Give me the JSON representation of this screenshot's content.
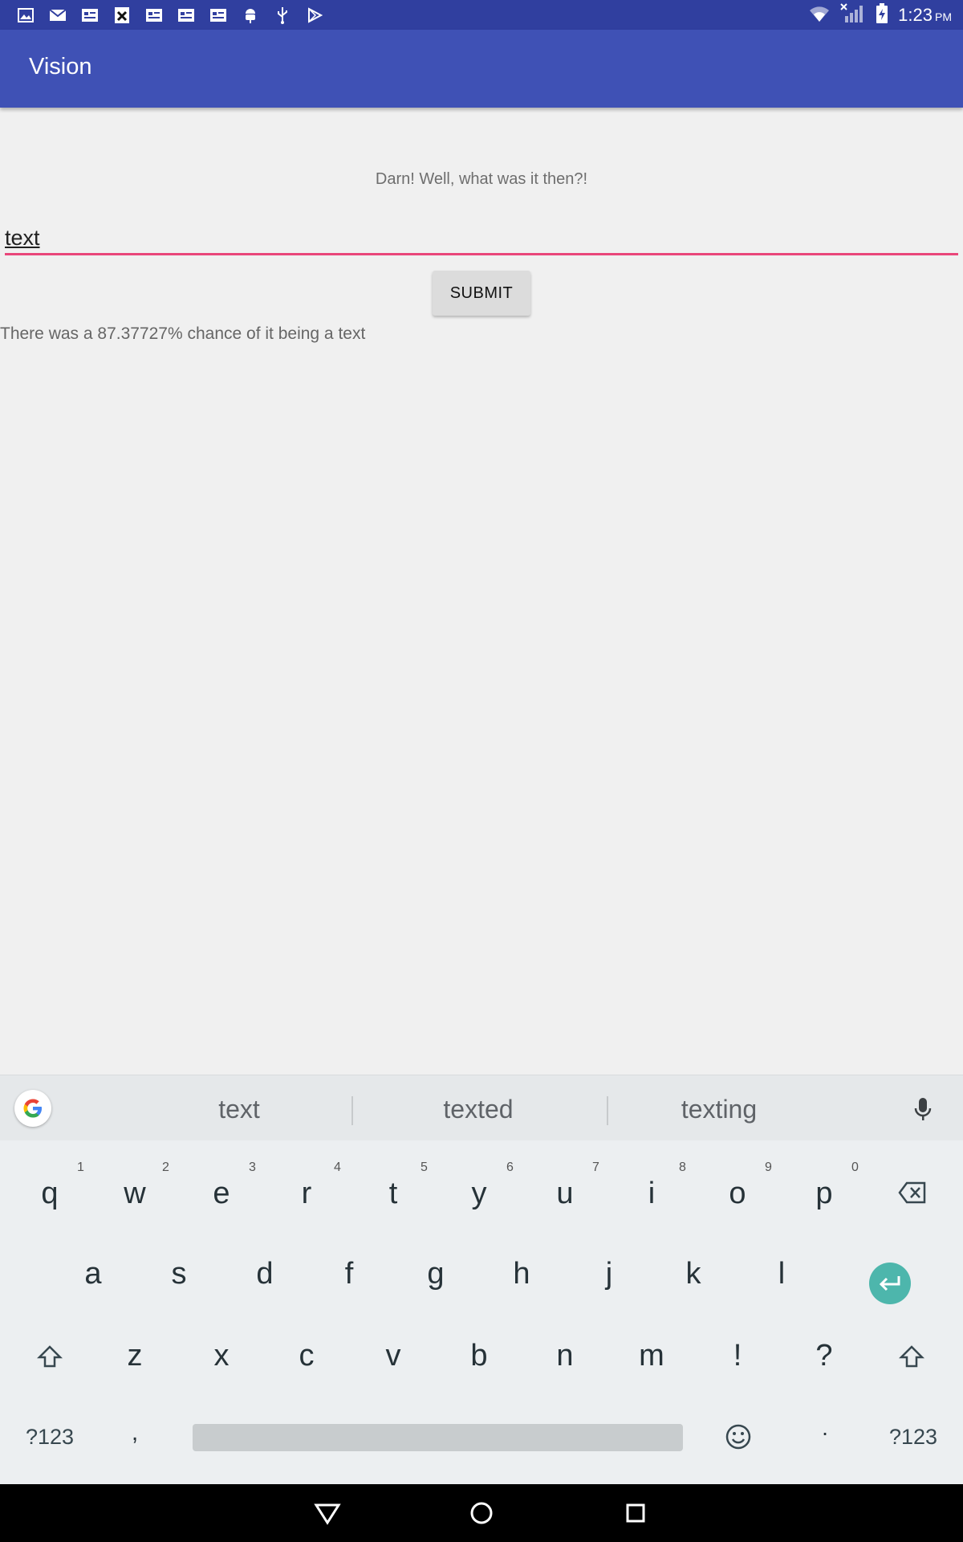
{
  "status_bar": {
    "time": "1:23",
    "ampm": "PM",
    "left_icons": [
      "image-icon",
      "mail-icon",
      "card-icon",
      "close-doc-icon",
      "card-icon",
      "card-icon",
      "card-icon",
      "android-icon",
      "usb-icon",
      "play-store-icon"
    ],
    "right_icons": [
      "wifi-icon",
      "signal-icon",
      "battery-charging-icon"
    ]
  },
  "app_bar": {
    "title": "Vision"
  },
  "main": {
    "prompt": "Darn! Well, what was it then?!",
    "answer_value": "text",
    "submit_label": "SUBMIT",
    "result_text": "There was a 87.37727% chance of it being a text"
  },
  "keyboard": {
    "suggestions": [
      "text",
      "texted",
      "texting"
    ],
    "row1": [
      {
        "key": "q",
        "hint": "1"
      },
      {
        "key": "w",
        "hint": "2"
      },
      {
        "key": "e",
        "hint": "3"
      },
      {
        "key": "r",
        "hint": "4"
      },
      {
        "key": "t",
        "hint": "5"
      },
      {
        "key": "y",
        "hint": "6"
      },
      {
        "key": "u",
        "hint": "7"
      },
      {
        "key": "i",
        "hint": "8"
      },
      {
        "key": "o",
        "hint": "9"
      },
      {
        "key": "p",
        "hint": "0"
      }
    ],
    "row2": [
      "a",
      "s",
      "d",
      "f",
      "g",
      "h",
      "j",
      "k",
      "l"
    ],
    "row3": [
      "z",
      "x",
      "c",
      "v",
      "b",
      "n",
      "m",
      "!",
      "?"
    ],
    "symbols_label": "?123",
    "comma_label": ",",
    "period_label": "·"
  },
  "colors": {
    "status_bar": "#303f9f",
    "app_bar": "#3f51b5",
    "accent": "#e9467a",
    "enter_key": "#4db6ac"
  }
}
